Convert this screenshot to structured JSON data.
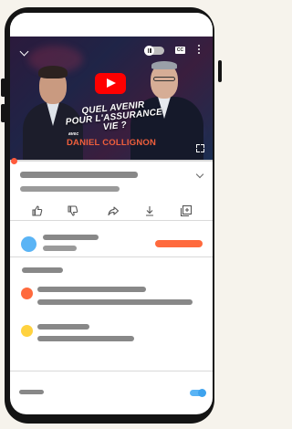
{
  "video": {
    "title_line1": "QUEL AVENIR",
    "title_line2": "POUR L'ASSURANCE VIE ?",
    "avec": "avec",
    "guest_name": "DANIEL COLLIGNON",
    "cc_label": "CC"
  },
  "icons": {
    "minimize": "chevron-down-icon",
    "autoplay": "autoplay-toggle-icon",
    "captions": "captions-icon",
    "more": "more-vertical-icon",
    "play": "play-icon",
    "fullscreen": "fullscreen-icon",
    "expand": "chevron-down-icon",
    "like": "thumbs-up-icon",
    "dislike": "thumbs-down-icon",
    "share": "share-icon",
    "download": "download-icon",
    "save": "add-to-playlist-icon"
  },
  "colors": {
    "accent": "#ff6a3d",
    "progress": "#ff5a3c",
    "youtube_red": "#ff0000",
    "avatar_blue": "#5ab4f5",
    "comment_orange": "#ff6a3d",
    "comment_yellow": "#ffd23f",
    "placeholder_gray": "#888888"
  }
}
